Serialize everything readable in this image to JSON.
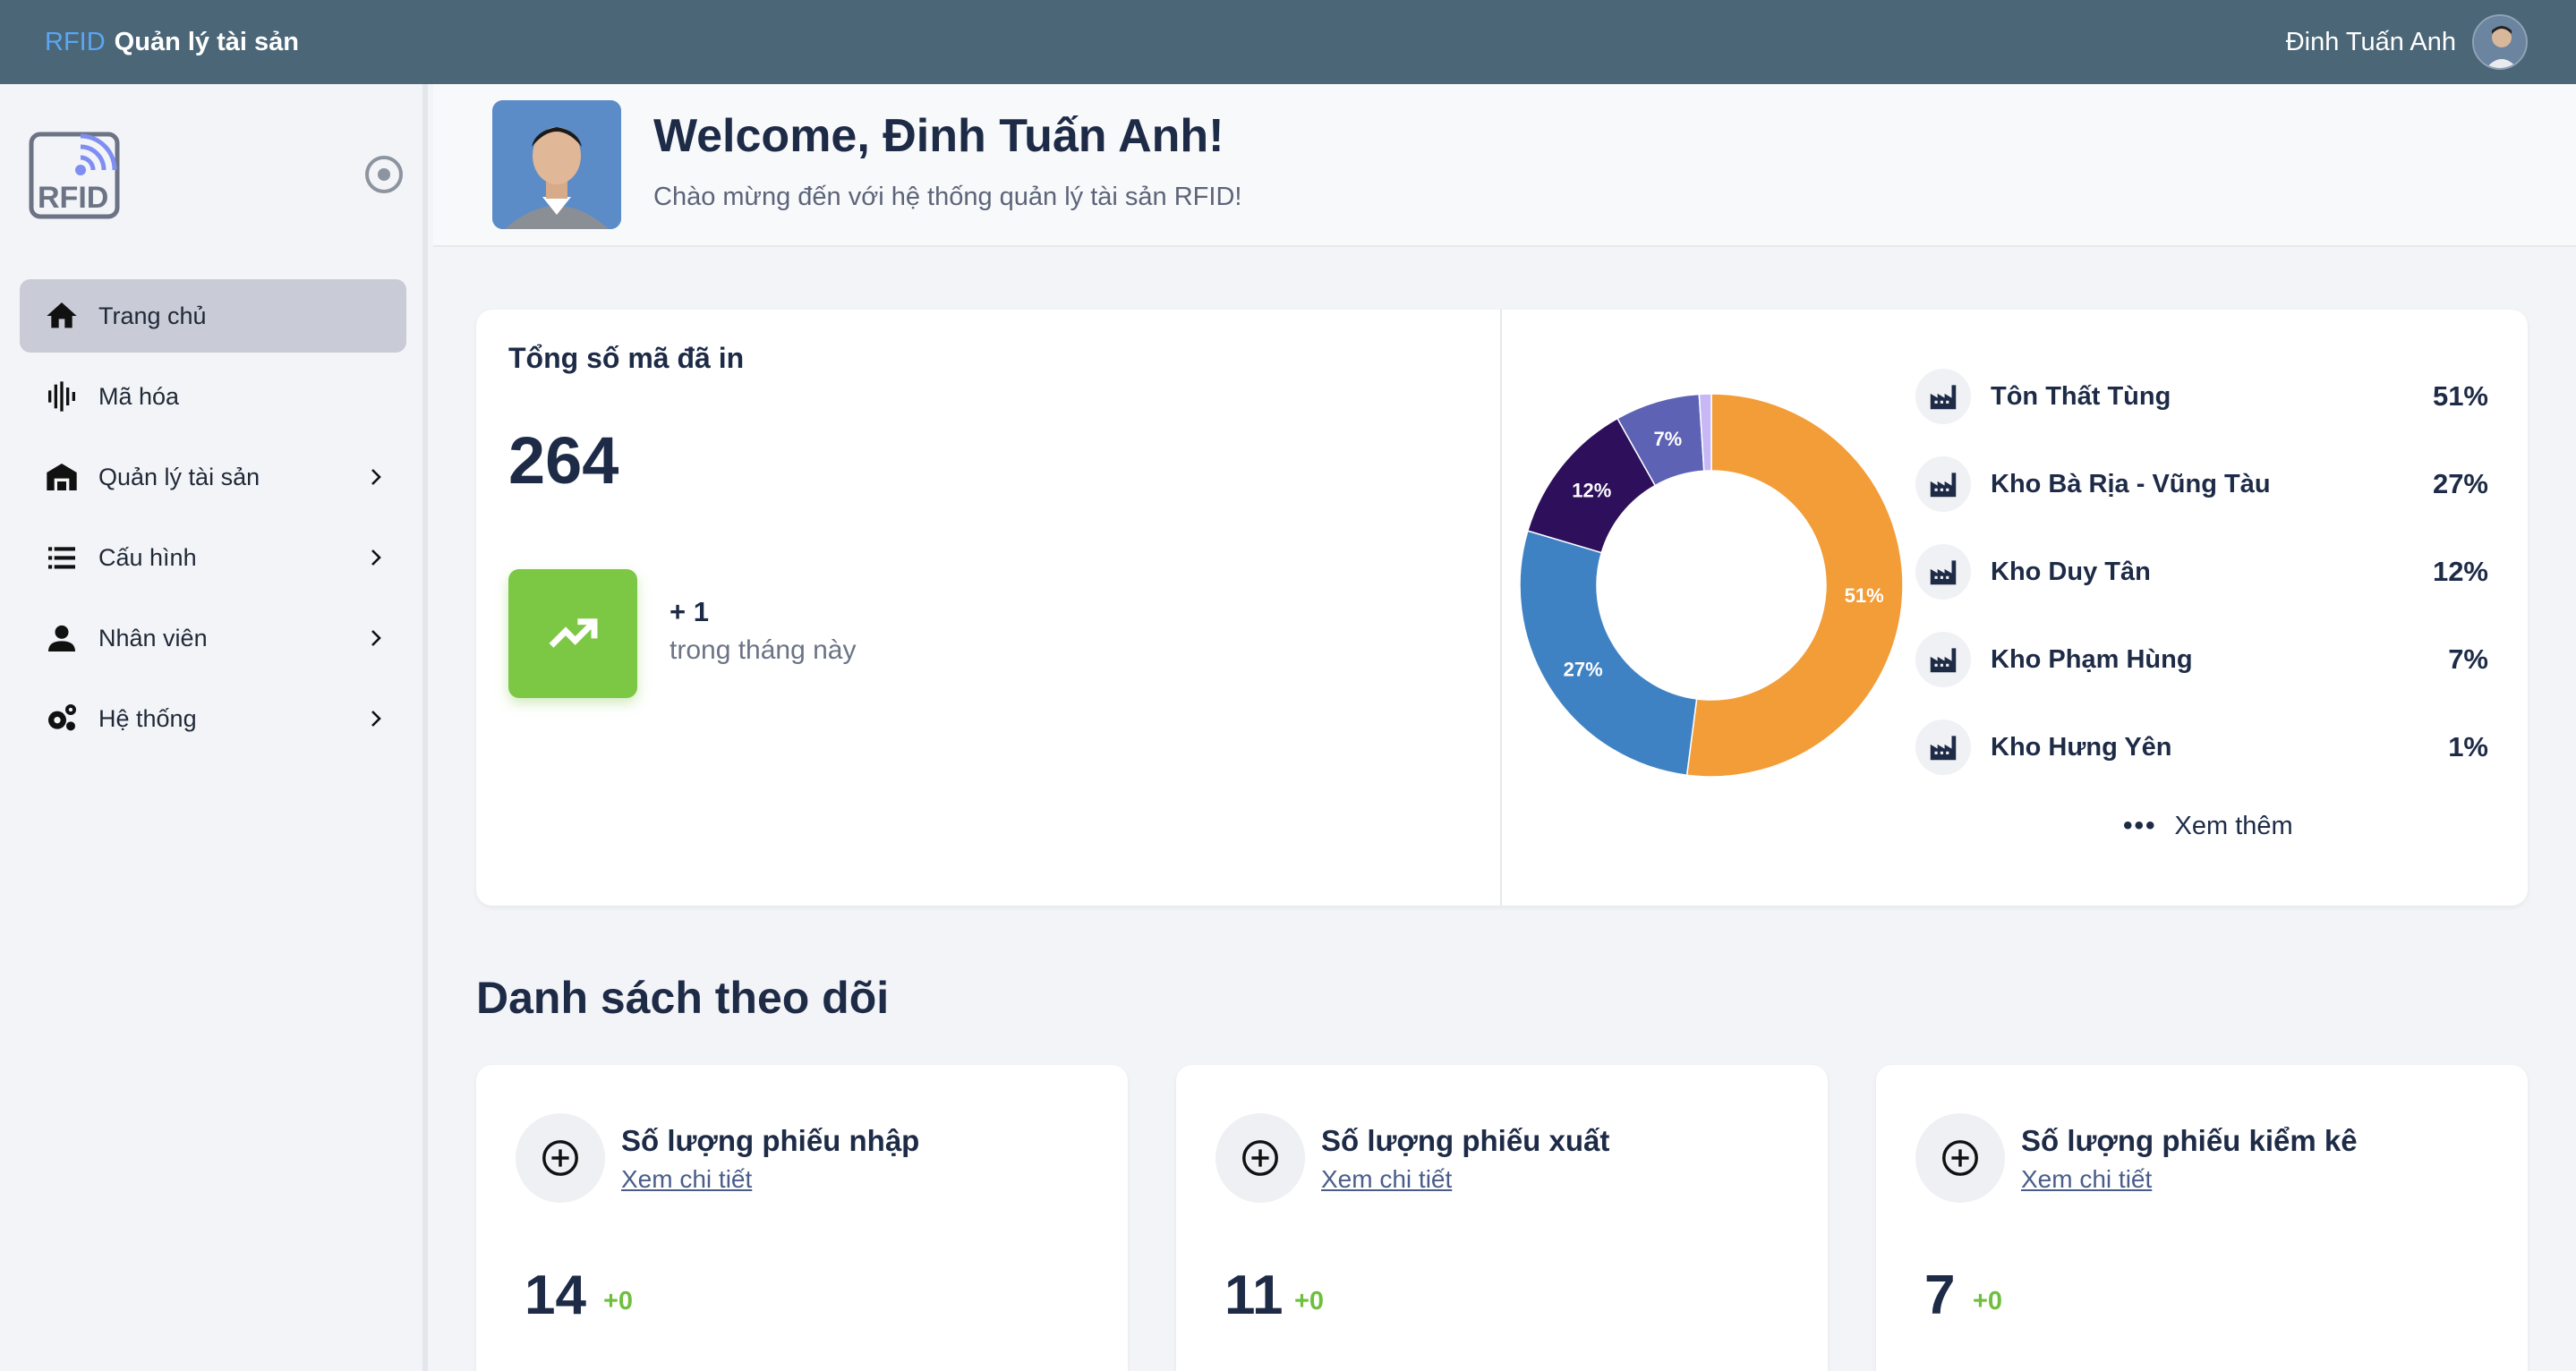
{
  "topbar": {
    "brand_prefix": "RFID",
    "app_name": "Quản lý tài sản",
    "user_name": "Đinh Tuấn Anh"
  },
  "sidebar": {
    "logo_text": "RFID",
    "items": [
      {
        "label": "Trang chủ",
        "icon": "home-icon",
        "active": true
      },
      {
        "label": "Mã hóa",
        "icon": "barcode-icon"
      },
      {
        "label": "Quản lý tài sản",
        "icon": "warehouse-icon",
        "has_submenu": true
      },
      {
        "label": "Cấu hình",
        "icon": "list-icon",
        "has_submenu": true
      },
      {
        "label": "Nhân viên",
        "icon": "person-icon",
        "has_submenu": true
      },
      {
        "label": "Hệ thống",
        "icon": "gears-icon",
        "has_submenu": true
      }
    ]
  },
  "welcome": {
    "title": "Welcome, Đinh Tuấn Anh!",
    "subtitle": "Chào mừng đến với hệ thống quản lý tài sản RFID!"
  },
  "stats": {
    "title": "Tổng số mã đã in",
    "total": "264",
    "delta": "+ 1",
    "delta_note": "trong tháng này",
    "trend_color": "#7cc744"
  },
  "chart_data": {
    "type": "pie",
    "categories": [
      "Tôn Thất Tùng",
      "Kho Bà Rịa - Vũng Tàu",
      "Kho Duy Tân",
      "Kho Phạm Hùng",
      "Kho Hưng Yên"
    ],
    "values": [
      51,
      27,
      12,
      7,
      1
    ],
    "labels": [
      "51%",
      "27%",
      "12%",
      "7%",
      "1%"
    ],
    "colors": [
      "#f29d38",
      "#3f82c4",
      "#2e0f5c",
      "#5d62b5",
      "#c7b8f5"
    ],
    "legend_position": "right"
  },
  "legend_more": "Xem thêm",
  "follow": {
    "title": "Danh sách theo dõi",
    "cards": [
      {
        "title": "Số lượng phiếu nhập",
        "link": "Xem chi tiết",
        "value": "14",
        "delta": "+0"
      },
      {
        "title": "Số lượng phiếu xuất",
        "link": "Xem chi tiết",
        "value": "11",
        "delta": "+0"
      },
      {
        "title": "Số lượng phiếu kiểm kê",
        "link": "Xem chi tiết",
        "value": "7",
        "delta": "+0"
      }
    ]
  }
}
